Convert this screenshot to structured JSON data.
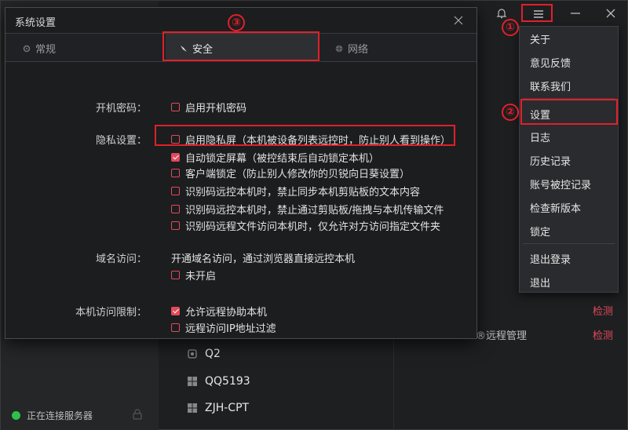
{
  "background": {
    "status_text": "正在连接服务器",
    "devices": [
      "Q2",
      "QQ5193",
      "ZJH-CPT"
    ],
    "detect_label": "检测",
    "remote_mgmt": "®远程管理"
  },
  "menu": {
    "items": [
      "关于",
      "意见反馈",
      "联系我们",
      "设置",
      "日志",
      "历史记录",
      "账号被控记录",
      "检查新版本",
      "锁定",
      "退出登录",
      "退出"
    ]
  },
  "annotations": {
    "n1": "①",
    "n2": "②",
    "n3": "③"
  },
  "dialog": {
    "title": "系统设置",
    "tabs": {
      "general": "常规",
      "security": "安全",
      "network": "网络"
    },
    "power_password": {
      "label": "开机密码：",
      "option": "启用开机密码",
      "checked": false
    },
    "privacy": {
      "label": "隐私设置：",
      "options": [
        {
          "text": "启用隐私屏（本机被设备列表远控时，防止别人看到操作）",
          "checked": false
        },
        {
          "text": "自动锁定屏幕（被控结束后自动锁定本机）",
          "checked": true
        },
        {
          "text": "客户端锁定（防止别人修改你的贝锐向日葵设置）",
          "checked": false
        },
        {
          "text": "识别码远控本机时，禁止同步本机剪贴板的文本内容",
          "checked": false
        },
        {
          "text": "识别码远控本机时，禁止通过剪贴板/拖拽与本机传输文件",
          "checked": false
        },
        {
          "text": "识别码远程文件访问本机时，仅允许对方访问指定文件夹",
          "checked": false
        }
      ]
    },
    "domain": {
      "label": "域名访问：",
      "desc": "开通域名访问，通过浏览器直接远控本机",
      "option": "未开启",
      "checked": false
    },
    "access_limit": {
      "label": "本机访问限制：",
      "options": [
        {
          "text": "允许远程协助本机",
          "checked": true
        },
        {
          "text": "远程访问IP地址过滤",
          "checked": false
        }
      ]
    }
  },
  "colors": {
    "accent": "#e14a5a",
    "annotation_red": "#e0202a",
    "status_green": "#2fbf4a"
  }
}
